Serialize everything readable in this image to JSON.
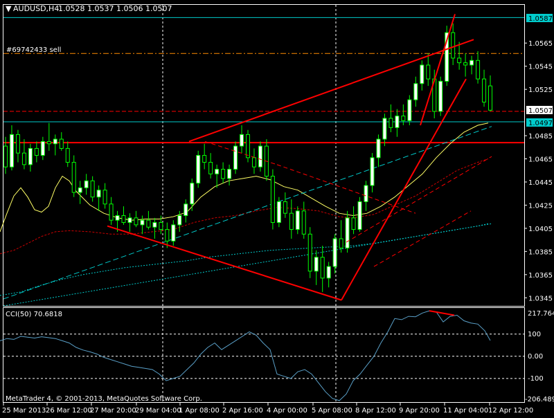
{
  "header": {
    "symbol_title": "AUDUSD,H4",
    "ohlc": "1.0528 1.0537 1.0506 1.0507",
    "order_label": "#69742433 sell"
  },
  "price_tags": {
    "top_line": "1.0587",
    "current": "1.0507",
    "level": "1.0497"
  },
  "indicator": {
    "label": "CCI(50) 70.6818",
    "axis_labels": [
      "217.7643",
      "100",
      "0.00",
      "-100",
      "-206.489"
    ]
  },
  "footer": {
    "copyright": "MetaTrader 4, © 2001-2013, MetaQuotes Software Corp."
  },
  "colors": {
    "background": "#000000",
    "bull_candle": "#ffffff",
    "bear_candle": "#000000",
    "wick": "#00ff00",
    "trendline": "#ff0000",
    "horizontal_line": "#ff0000",
    "aqua_line": "#00cccc",
    "order_line": "#ff8c00",
    "ma_yellow": "#ffff66",
    "ma_red": "#cc0000",
    "cci_line": "#5aa0c8",
    "grid": "#ffffff"
  },
  "chart_data": {
    "type": "candlestick",
    "price_axis_ticks": [
      "1.0565",
      "1.0545",
      "1.0525",
      "1.0485",
      "1.0465",
      "1.0445",
      "1.0425",
      "1.0405",
      "1.0385",
      "1.0365",
      "1.0345"
    ],
    "price_ticks": [
      1.0565,
      1.0545,
      1.0525,
      1.0485,
      1.0465,
      1.0445,
      1.0425,
      1.0405,
      1.0385,
      1.0365,
      1.0345
    ],
    "time_axis_labels": [
      "25 Mar 2013",
      "26 Mar 12:00",
      "27 Mar 20:00",
      "29 Mar 04:00",
      "1 Apr 08:00",
      "2 Apr 16:00",
      "4 Apr 00:00",
      "5 Apr 08:00",
      "8 Apr 12:00",
      "9 Apr 20:00",
      "11 Apr 04:00",
      "12 Apr 12:00"
    ],
    "ylim": [
      1.0338,
      1.0598
    ],
    "horizontal_levels": [
      1.0587,
      1.0497,
      1.0479,
      1.0506
    ],
    "order_level": 1.0556,
    "cci_ylim": [
      -206.489,
      217.7643
    ],
    "cci_levels": [
      100,
      0,
      -100
    ],
    "candles": [
      [
        1.0476,
        1.0484,
        1.0452,
        1.0458
      ],
      [
        1.0458,
        1.0494,
        1.0455,
        1.0486
      ],
      [
        1.0486,
        1.049,
        1.0462,
        1.047
      ],
      [
        1.047,
        1.0482,
        1.0456,
        1.046
      ],
      [
        1.046,
        1.0478,
        1.0454,
        1.0474
      ],
      [
        1.0474,
        1.048,
        1.0462,
        1.0468
      ],
      [
        1.0468,
        1.0484,
        1.0464,
        1.048
      ],
      [
        1.048,
        1.0496,
        1.0472,
        1.0478
      ],
      [
        1.0478,
        1.0486,
        1.0468,
        1.0482
      ],
      [
        1.0482,
        1.0488,
        1.0472,
        1.0474
      ],
      [
        1.0474,
        1.048,
        1.0458,
        1.0462
      ],
      [
        1.0462,
        1.0468,
        1.0432,
        1.0436
      ],
      [
        1.0436,
        1.0446,
        1.0426,
        1.044
      ],
      [
        1.044,
        1.0452,
        1.0434,
        1.0446
      ],
      [
        1.0446,
        1.045,
        1.0428,
        1.0432
      ],
      [
        1.0432,
        1.0442,
        1.042,
        1.0438
      ],
      [
        1.0438,
        1.0444,
        1.0422,
        1.0426
      ],
      [
        1.0426,
        1.0432,
        1.0408,
        1.0412
      ],
      [
        1.0412,
        1.042,
        1.0402,
        1.0416
      ],
      [
        1.0416,
        1.0424,
        1.0408,
        1.041
      ],
      [
        1.041,
        1.0418,
        1.0402,
        1.0414
      ],
      [
        1.0414,
        1.042,
        1.0406,
        1.0408
      ],
      [
        1.0408,
        1.0416,
        1.04,
        1.0412
      ],
      [
        1.0412,
        1.042,
        1.0404,
        1.0406
      ],
      [
        1.0406,
        1.0414,
        1.0396,
        1.041
      ],
      [
        1.041,
        1.0416,
        1.04,
        1.0404
      ],
      [
        1.0404,
        1.041,
        1.0388,
        1.0394
      ],
      [
        1.0394,
        1.0412,
        1.039,
        1.0408
      ],
      [
        1.0408,
        1.042,
        1.0402,
        1.0416
      ],
      [
        1.0416,
        1.043,
        1.041,
        1.0426
      ],
      [
        1.0426,
        1.0448,
        1.042,
        1.0444
      ],
      [
        1.0444,
        1.0472,
        1.044,
        1.0468
      ],
      [
        1.0468,
        1.0478,
        1.0456,
        1.0462
      ],
      [
        1.0462,
        1.047,
        1.0448,
        1.0452
      ],
      [
        1.0452,
        1.046,
        1.044,
        1.0456
      ],
      [
        1.0456,
        1.0462,
        1.0444,
        1.0448
      ],
      [
        1.0448,
        1.046,
        1.0442,
        1.0456
      ],
      [
        1.0456,
        1.048,
        1.0452,
        1.0476
      ],
      [
        1.0476,
        1.0494,
        1.047,
        1.0486
      ],
      [
        1.0486,
        1.049,
        1.0462,
        1.0466
      ],
      [
        1.0466,
        1.0474,
        1.0452,
        1.0458
      ],
      [
        1.0458,
        1.048,
        1.0454,
        1.0476
      ],
      [
        1.0476,
        1.0482,
        1.0446,
        1.045
      ],
      [
        1.045,
        1.0456,
        1.0404,
        1.041
      ],
      [
        1.041,
        1.0432,
        1.0406,
        1.0428
      ],
      [
        1.0428,
        1.0436,
        1.0414,
        1.0418
      ],
      [
        1.0418,
        1.043,
        1.0396,
        1.0404
      ],
      [
        1.0404,
        1.0424,
        1.04,
        1.042
      ],
      [
        1.042,
        1.0428,
        1.0396,
        1.04
      ],
      [
        1.04,
        1.0406,
        1.0362,
        1.0368
      ],
      [
        1.0368,
        1.0386,
        1.0356,
        1.038
      ],
      [
        1.038,
        1.039,
        1.035,
        1.0362
      ],
      [
        1.0362,
        1.0376,
        1.0354,
        1.0372
      ],
      [
        1.0372,
        1.04,
        1.0366,
        1.0396
      ],
      [
        1.0396,
        1.0412,
        1.0384,
        1.0388
      ],
      [
        1.0388,
        1.042,
        1.0384,
        1.0414
      ],
      [
        1.0414,
        1.0424,
        1.04,
        1.0404
      ],
      [
        1.0404,
        1.0432,
        1.0402,
        1.0428
      ],
      [
        1.0428,
        1.0446,
        1.042,
        1.0442
      ],
      [
        1.0442,
        1.047,
        1.0436,
        1.0466
      ],
      [
        1.0466,
        1.0486,
        1.0458,
        1.0482
      ],
      [
        1.0482,
        1.0504,
        1.0476,
        1.05
      ],
      [
        1.05,
        1.0512,
        1.0488,
        1.0492
      ],
      [
        1.0492,
        1.0508,
        1.0484,
        1.0502
      ],
      [
        1.0502,
        1.0512,
        1.0494,
        1.0498
      ],
      [
        1.0498,
        1.052,
        1.0494,
        1.0516
      ],
      [
        1.0516,
        1.0536,
        1.051,
        1.053
      ],
      [
        1.053,
        1.055,
        1.0524,
        1.0546
      ],
      [
        1.0546,
        1.0556,
        1.0528,
        1.0534
      ],
      [
        1.0534,
        1.0542,
        1.05,
        1.0506
      ],
      [
        1.0506,
        1.0536,
        1.0502,
        1.0532
      ],
      [
        1.0532,
        1.058,
        1.0528,
        1.0574
      ],
      [
        1.0574,
        1.0582,
        1.0546,
        1.0552
      ],
      [
        1.0552,
        1.0566,
        1.0542,
        1.0548
      ],
      [
        1.0548,
        1.0556,
        1.0536,
        1.0546
      ],
      [
        1.0546,
        1.0554,
        1.0538,
        1.055
      ],
      [
        1.055,
        1.0558,
        1.053,
        1.0534
      ],
      [
        1.0534,
        1.0542,
        1.051,
        1.0514
      ],
      [
        1.0528,
        1.0537,
        1.0506,
        1.0507
      ]
    ],
    "ma_yellow": [
      [
        0,
        1.0402
      ],
      [
        10,
        1.0418
      ],
      [
        20,
        1.0433
      ],
      [
        30,
        1.044
      ],
      [
        40,
        1.0432
      ],
      [
        50,
        1.0421
      ],
      [
        60,
        1.0419
      ],
      [
        70,
        1.0424
      ],
      [
        80,
        1.044
      ],
      [
        90,
        1.045
      ],
      [
        100,
        1.0446
      ],
      [
        110,
        1.0437
      ],
      [
        130,
        1.0425
      ],
      [
        150,
        1.0418
      ],
      [
        170,
        1.0414
      ],
      [
        190,
        1.0412
      ],
      [
        210,
        1.0413
      ],
      [
        230,
        1.0413
      ],
      [
        250,
        1.0415
      ],
      [
        270,
        1.0419
      ],
      [
        290,
        1.0432
      ],
      [
        310,
        1.0441
      ],
      [
        330,
        1.0446
      ],
      [
        350,
        1.0448
      ],
      [
        370,
        1.045
      ],
      [
        390,
        1.0447
      ],
      [
        410,
        1.0441
      ],
      [
        430,
        1.0438
      ],
      [
        450,
        1.0431
      ],
      [
        470,
        1.0424
      ],
      [
        490,
        1.0418
      ],
      [
        510,
        1.0416
      ],
      [
        530,
        1.0418
      ],
      [
        550,
        1.0424
      ],
      [
        570,
        1.0432
      ],
      [
        590,
        1.0442
      ],
      [
        610,
        1.0452
      ],
      [
        630,
        1.0466
      ],
      [
        650,
        1.0478
      ],
      [
        670,
        1.0488
      ],
      [
        690,
        1.0494
      ],
      [
        705,
        1.0496
      ]
    ],
    "ma_red": [
      [
        0,
        1.0383
      ],
      [
        20,
        1.0386
      ],
      [
        40,
        1.0392
      ],
      [
        60,
        1.0398
      ],
      [
        80,
        1.0402
      ],
      [
        100,
        1.0403
      ],
      [
        130,
        1.0402
      ],
      [
        160,
        1.04
      ],
      [
        190,
        1.04
      ],
      [
        220,
        1.0402
      ],
      [
        250,
        1.0404
      ],
      [
        280,
        1.041
      ],
      [
        310,
        1.0414
      ],
      [
        340,
        1.0416
      ],
      [
        370,
        1.042
      ],
      [
        400,
        1.0423
      ],
      [
        430,
        1.0422
      ],
      [
        460,
        1.042
      ],
      [
        490,
        1.0415
      ],
      [
        510,
        1.0414
      ],
      [
        540,
        1.0417
      ],
      [
        570,
        1.0425
      ],
      [
        600,
        1.0433
      ],
      [
        630,
        1.0444
      ],
      [
        660,
        1.0455
      ],
      [
        690,
        1.0462
      ],
      [
        705,
        1.0465
      ]
    ],
    "ma_aqua": [
      [
        0,
        1.0347
      ],
      [
        30,
        1.035
      ],
      [
        60,
        1.0356
      ],
      [
        90,
        1.0361
      ],
      [
        120,
        1.0365
      ],
      [
        150,
        1.0368
      ],
      [
        180,
        1.0371
      ],
      [
        210,
        1.0373
      ],
      [
        240,
        1.0375
      ],
      [
        270,
        1.0377
      ],
      [
        300,
        1.038
      ],
      [
        330,
        1.0382
      ],
      [
        360,
        1.0384
      ],
      [
        390,
        1.0386
      ],
      [
        420,
        1.0387
      ],
      [
        450,
        1.0388
      ],
      [
        480,
        1.0389
      ],
      [
        510,
        1.039
      ],
      [
        540,
        1.0392
      ],
      [
        570,
        1.0395
      ],
      [
        600,
        1.0398
      ],
      [
        630,
        1.0401
      ],
      [
        660,
        1.0404
      ],
      [
        690,
        1.0407
      ],
      [
        705,
        1.0409
      ]
    ],
    "cci": [
      [
        0,
        70
      ],
      [
        10,
        80
      ],
      [
        20,
        76
      ],
      [
        30,
        90
      ],
      [
        40,
        86
      ],
      [
        50,
        82
      ],
      [
        60,
        88
      ],
      [
        70,
        84
      ],
      [
        80,
        80
      ],
      [
        90,
        70
      ],
      [
        100,
        60
      ],
      [
        110,
        40
      ],
      [
        120,
        28
      ],
      [
        130,
        20
      ],
      [
        140,
        10
      ],
      [
        150,
        -5
      ],
      [
        160,
        -15
      ],
      [
        170,
        -25
      ],
      [
        180,
        -35
      ],
      [
        190,
        -45
      ],
      [
        200,
        -50
      ],
      [
        210,
        -55
      ],
      [
        220,
        -60
      ],
      [
        230,
        -80
      ],
      [
        240,
        -110
      ],
      [
        250,
        -100
      ],
      [
        260,
        -90
      ],
      [
        270,
        -60
      ],
      [
        280,
        -30
      ],
      [
        290,
        10
      ],
      [
        300,
        40
      ],
      [
        310,
        60
      ],
      [
        320,
        30
      ],
      [
        330,
        50
      ],
      [
        340,
        70
      ],
      [
        350,
        90
      ],
      [
        360,
        110
      ],
      [
        370,
        95
      ],
      [
        380,
        60
      ],
      [
        390,
        30
      ],
      [
        400,
        -80
      ],
      [
        410,
        -90
      ],
      [
        420,
        -100
      ],
      [
        430,
        -70
      ],
      [
        440,
        -60
      ],
      [
        450,
        -80
      ],
      [
        460,
        -120
      ],
      [
        470,
        -160
      ],
      [
        480,
        -190
      ],
      [
        490,
        -200
      ],
      [
        500,
        -170
      ],
      [
        510,
        -110
      ],
      [
        520,
        -80
      ],
      [
        530,
        -40
      ],
      [
        540,
        0
      ],
      [
        550,
        60
      ],
      [
        560,
        110
      ],
      [
        570,
        170
      ],
      [
        580,
        165
      ],
      [
        590,
        180
      ],
      [
        600,
        178
      ],
      [
        610,
        195
      ],
      [
        620,
        205
      ],
      [
        630,
        200
      ],
      [
        640,
        155
      ],
      [
        650,
        180
      ],
      [
        660,
        185
      ],
      [
        670,
        160
      ],
      [
        680,
        150
      ],
      [
        690,
        145
      ],
      [
        700,
        115
      ],
      [
        708,
        71
      ]
    ],
    "trendlines": [
      [
        155,
        1.0407,
        493,
        1.0343
      ],
      [
        273,
        1.048,
        684,
        1.0568
      ],
      [
        493,
        1.0343,
        673,
        1.0534
      ],
      [
        607,
        1.0494,
        657,
        1.059
      ],
      [
        296,
        1.048,
        400,
        1.046
      ],
      [
        400,
        1.046,
        600,
        1.0418
      ],
      [
        500,
        1.0393,
        710,
        1.0467
      ],
      [
        540,
        1.0372,
        680,
        1.042
      ]
    ],
    "dashed_lines": [
      [
        5,
        1.0344,
        710,
        1.0493
      ],
      [
        5,
        1.0338,
        710,
        1.0409
      ]
    ],
    "vertical_dashed_x": [
      235,
      485
    ]
  }
}
